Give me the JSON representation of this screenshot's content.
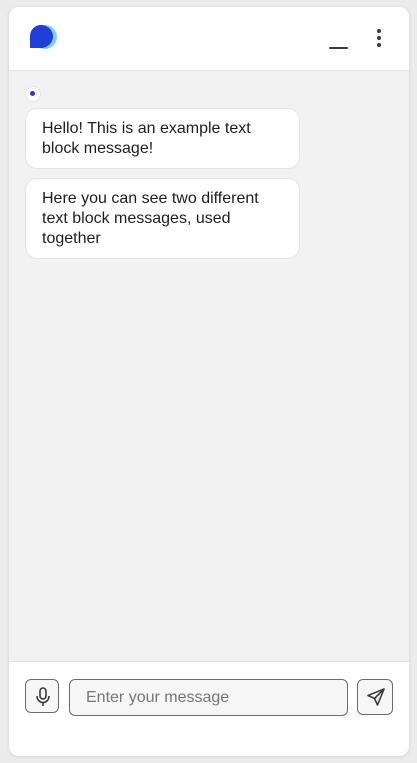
{
  "header": {
    "logo_icon": "chat-bubble-logo-icon",
    "minimize_icon": "minimize-icon",
    "menu_icon": "more-vertical-icon"
  },
  "colors": {
    "brand_primary": "#1f3fd8",
    "brand_secondary": "#7fd3e6",
    "background": "#f2f2f2"
  },
  "messages": [
    {
      "sender": "bot",
      "text": "Hello! This is an example text block message!"
    },
    {
      "sender": "bot",
      "text": "Here you can see two different text block messages, used together"
    }
  ],
  "composer": {
    "mic_icon": "microphone-icon",
    "placeholder": "Enter your message",
    "value": "",
    "send_icon": "send-icon"
  }
}
